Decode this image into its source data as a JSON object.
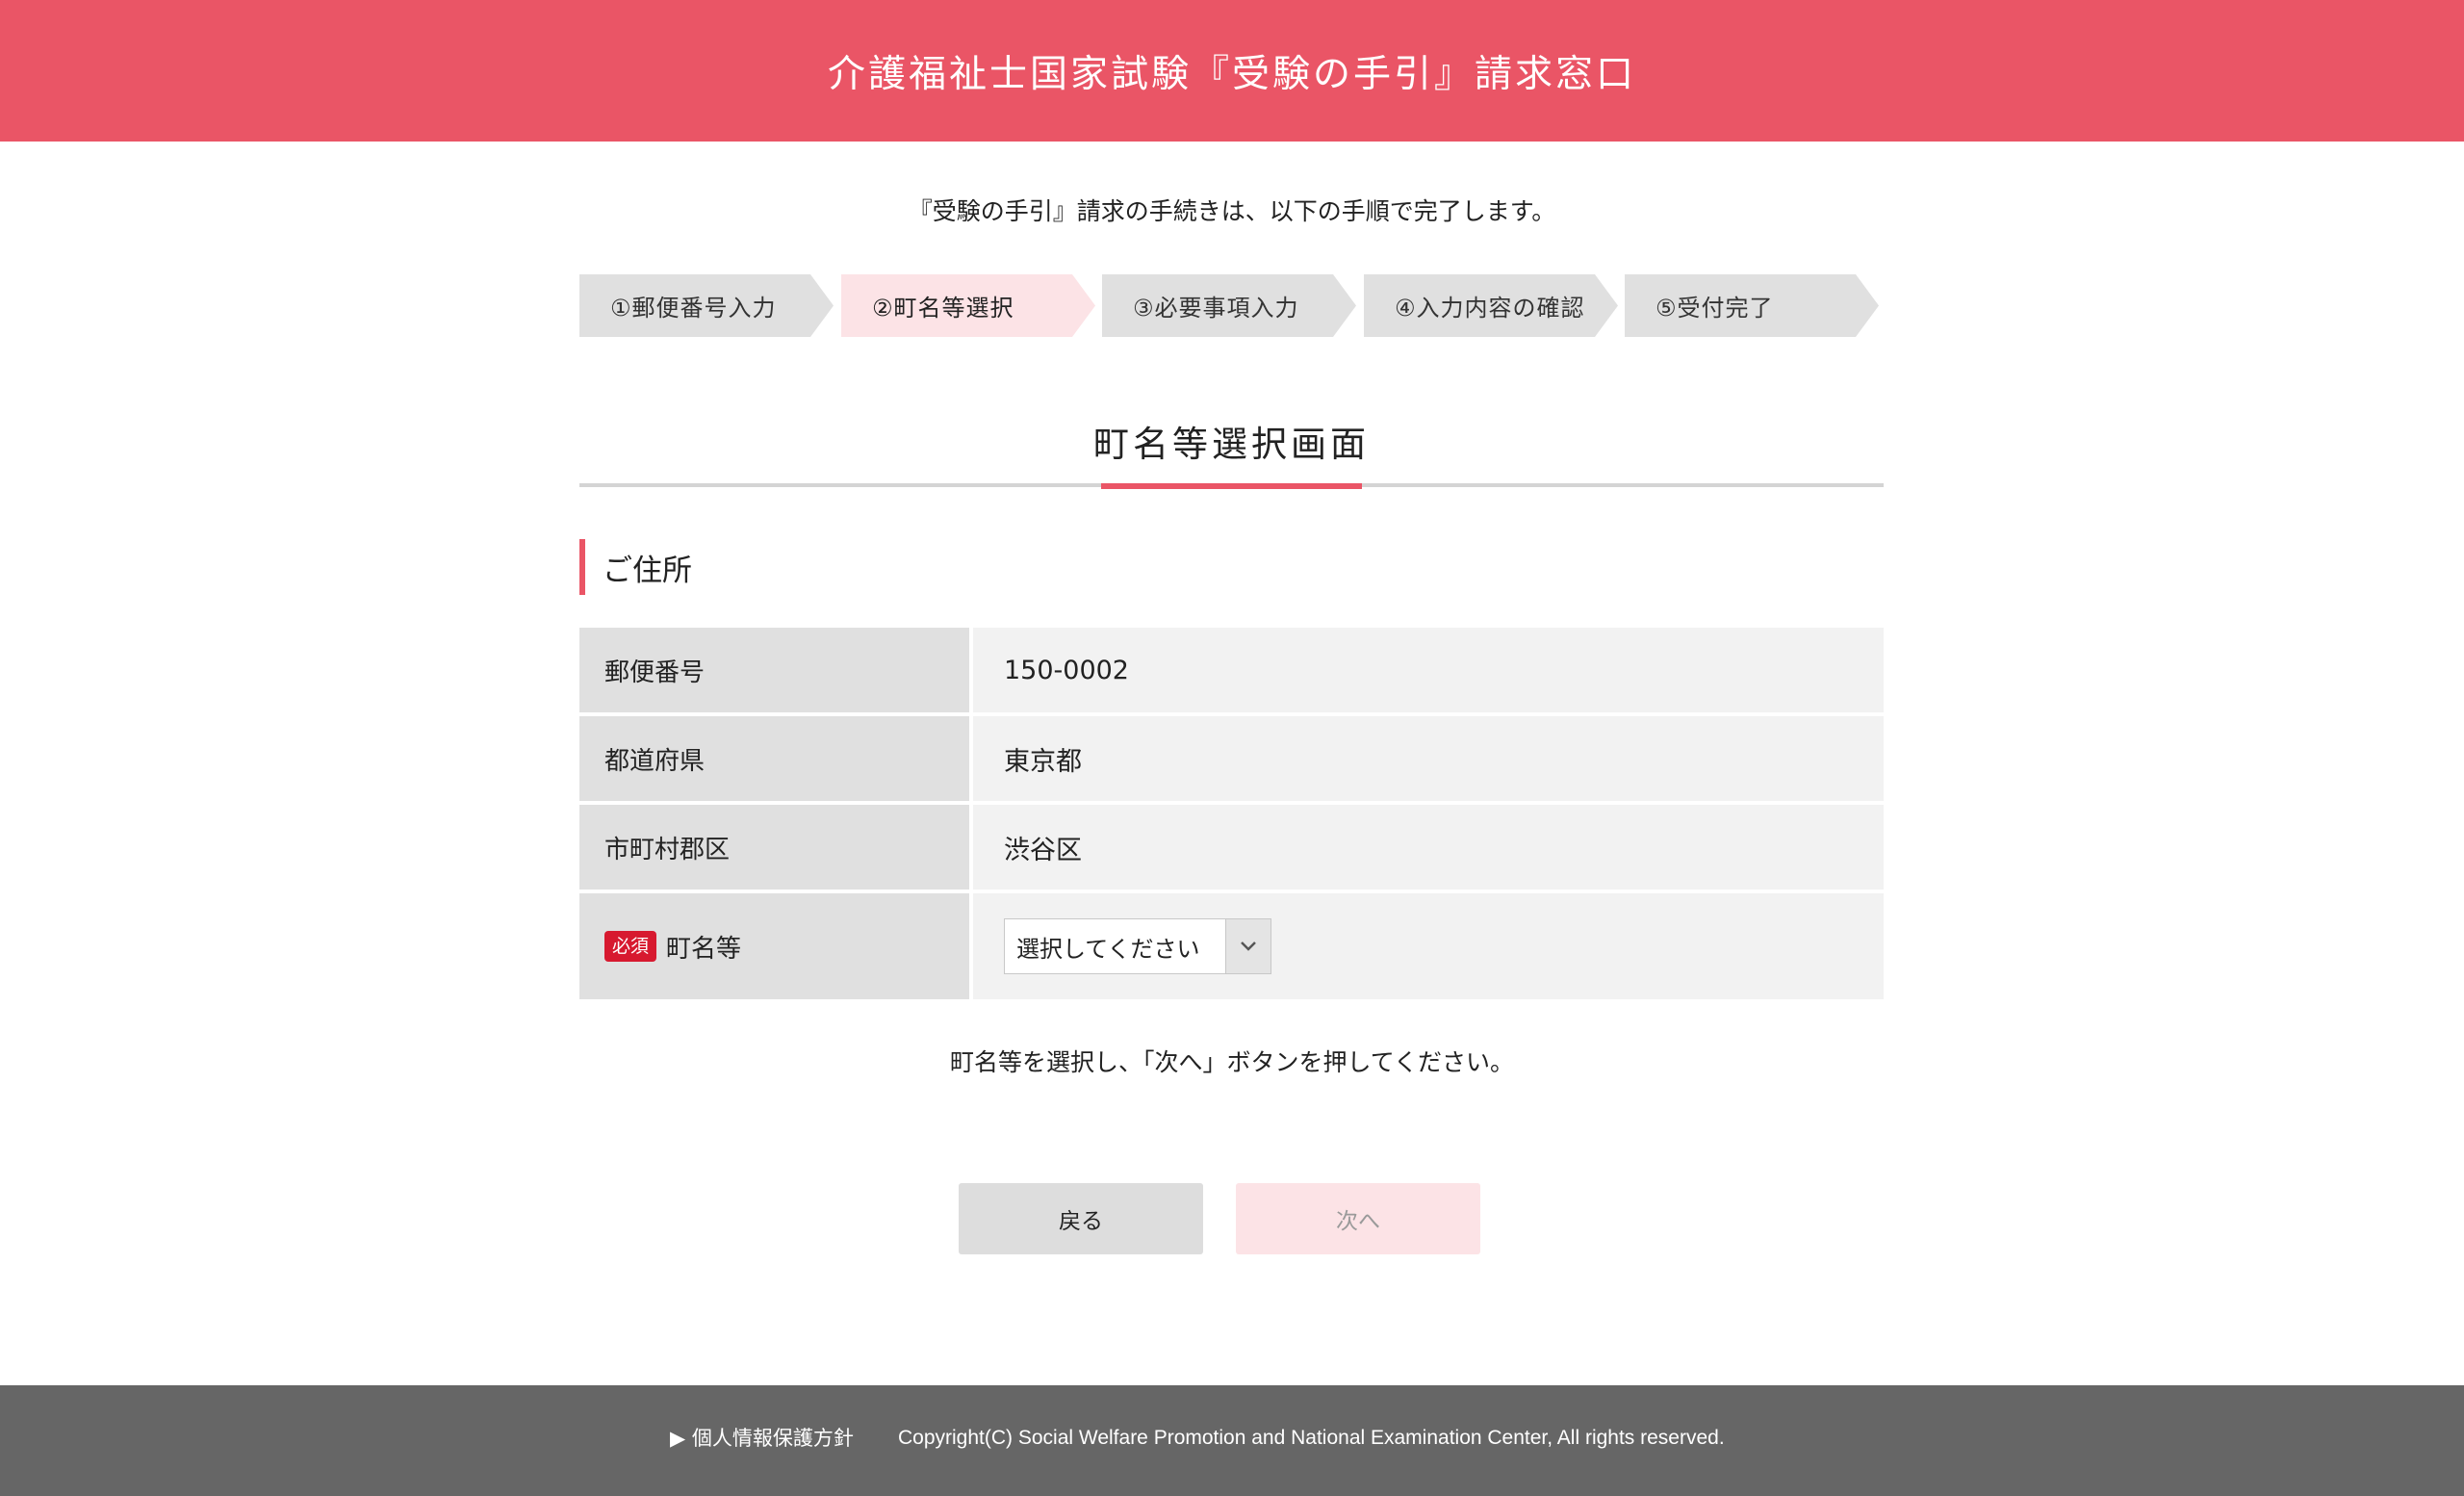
{
  "header": {
    "title": "介護福祉士国家試験『受験の手引』請求窓口"
  },
  "intro": "『受験の手引』請求の手続きは、以下の手順で完了します。",
  "steps": [
    {
      "label": "①郵便番号入力",
      "active": false
    },
    {
      "label": "②町名等選択",
      "active": true
    },
    {
      "label": "③必要事項入力",
      "active": false
    },
    {
      "label": "④入力内容の確認",
      "active": false
    },
    {
      "label": "⑤受付完了",
      "active": false
    }
  ],
  "page_title": "町名等選択画面",
  "section_title": "ご住所",
  "form": {
    "postal_code": {
      "label": "郵便番号",
      "value": "150-0002"
    },
    "prefecture": {
      "label": "都道府県",
      "value": "東京都"
    },
    "city": {
      "label": "市町村郡区",
      "value": "渋谷区"
    },
    "town": {
      "required_badge": "必須",
      "label": "町名等",
      "select_value": "選択してください"
    }
  },
  "instruction": "町名等を選択し、「次へ」ボタンを押してください。",
  "buttons": {
    "back": "戻る",
    "next": "次へ"
  },
  "footer": {
    "privacy_link": "▶ 個人情報保護方針",
    "copyright": "Copyright(C) Social Welfare Promotion and National Examination Center, All rights reserved."
  },
  "colors": {
    "brand": "#ea5566",
    "active_step": "#fce3e6",
    "required_badge": "#d7192f",
    "footer": "#666666"
  }
}
